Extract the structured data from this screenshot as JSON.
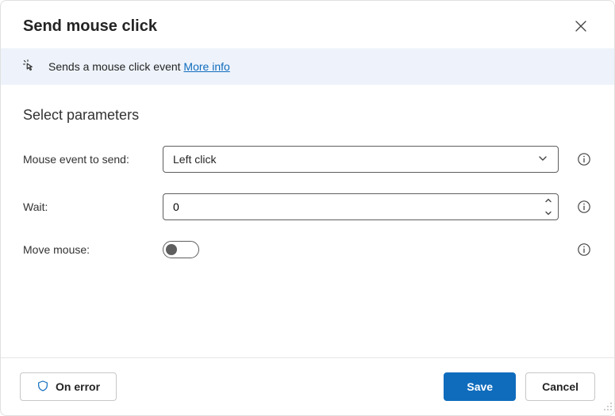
{
  "dialog": {
    "title": "Send mouse click"
  },
  "banner": {
    "text": "Sends a mouse click event ",
    "link": "More info"
  },
  "section": {
    "title": "Select parameters"
  },
  "params": {
    "mouse_event": {
      "label": "Mouse event to send:",
      "value": "Left click"
    },
    "wait": {
      "label": "Wait:",
      "value": "0"
    },
    "move_mouse": {
      "label": "Move mouse:",
      "on": false
    }
  },
  "footer": {
    "on_error": "On error",
    "save": "Save",
    "cancel": "Cancel"
  }
}
